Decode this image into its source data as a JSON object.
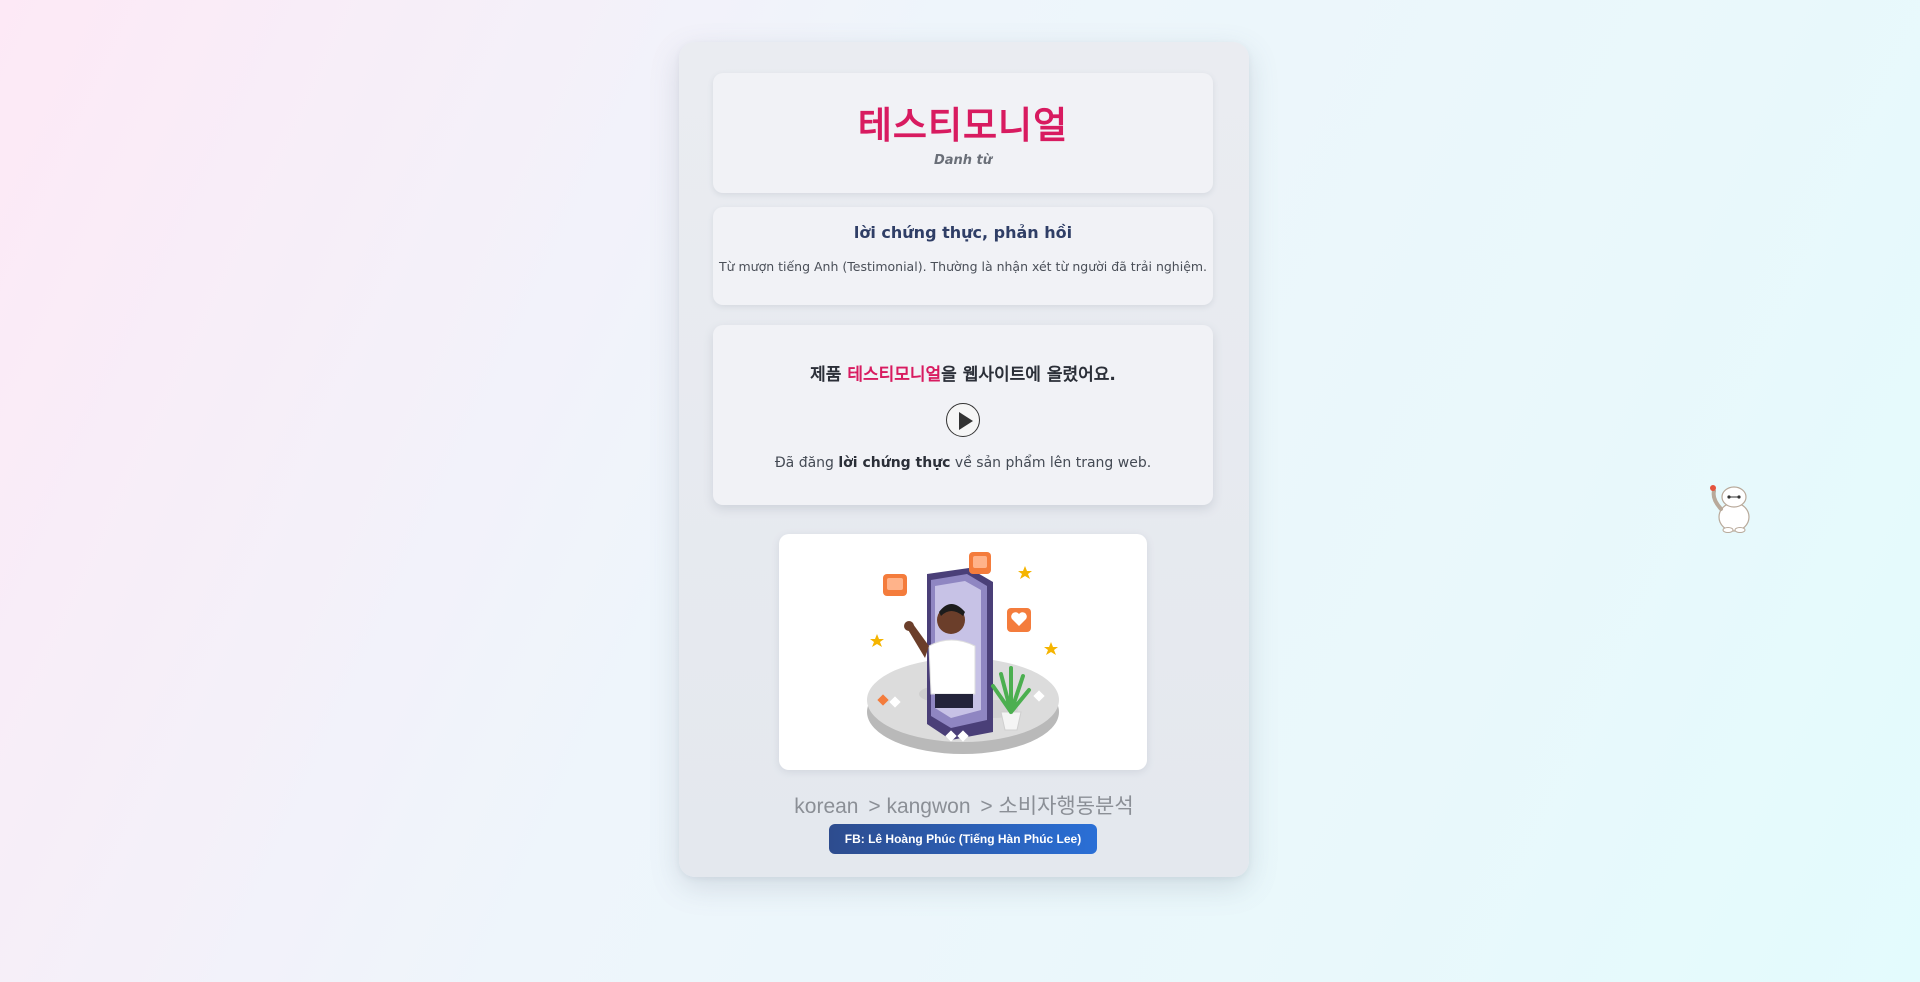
{
  "word": "테스티모니얼",
  "part_of_speech": "Danh từ",
  "meaning": "lời chứng thực, phản hồi",
  "note": "Từ mượn tiếng Anh (Testimonial). Thường là nhận xét từ người đã trải nghiệm.",
  "example": {
    "before": "제품 ",
    "highlight": "테스티모니얼",
    "after": "을 웹사이트에 올렸어요.",
    "translation_before": "Đã đăng ",
    "translation_bold": "lời chứng thực",
    "translation_after": " về sản phẩm lên trang web."
  },
  "breadcrumb": [
    "korean",
    "> kangwon",
    "> 소비자행동분석"
  ],
  "fb_label": "FB: Lê Hoàng Phúc (Tiếng Hàn Phúc Lee)",
  "colors": {
    "accent": "#d81b60",
    "meaning": "#2f3e66",
    "button_start": "#2d4c8e",
    "button_end": "#2a6fd6"
  },
  "icons": [
    "play-icon",
    "testimonial-illustration",
    "mascot-icon"
  ]
}
